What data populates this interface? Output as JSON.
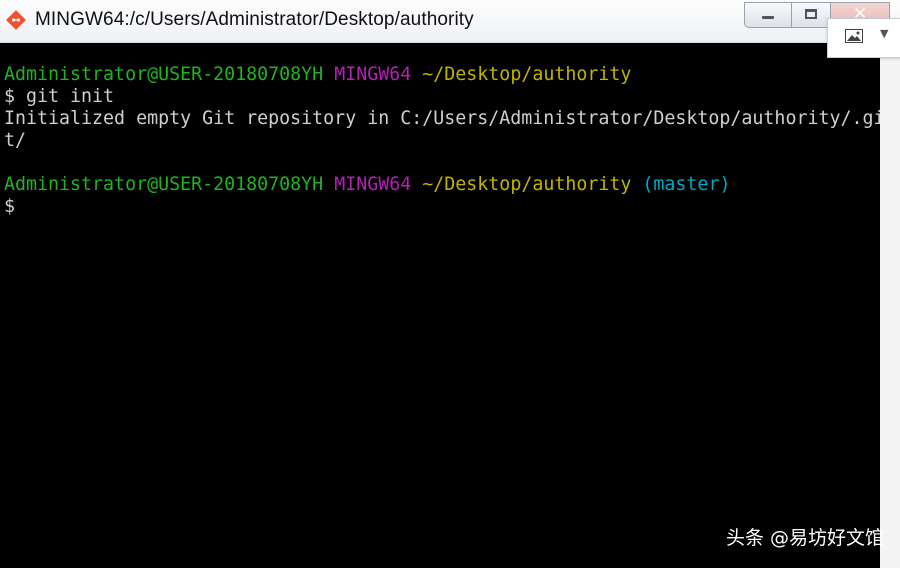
{
  "window": {
    "title": "MINGW64:/c/Users/Administrator/Desktop/authority"
  },
  "terminal": {
    "prompt1": {
      "user": "Administrator@USER-20180708YH",
      "system": "MINGW64",
      "path": "~/Desktop/authority"
    },
    "command1": "$ git init",
    "output1_line1": "Initialized empty Git repository in C:/Users/Administrator/Desktop/authority/.gi",
    "output1_line2": "t/",
    "prompt2": {
      "user": "Administrator@USER-20180708YH",
      "system": "MINGW64",
      "path": "~/Desktop/authority",
      "branch": "(master)"
    },
    "cursor_prompt": "$"
  },
  "watermark": {
    "text": "头条 @易坊好文馆"
  },
  "colors": {
    "terminal_bg": "#000000",
    "user": "#1fb41f",
    "system": "#b320b3",
    "path": "#c1b300",
    "branch": "#00a8c6",
    "text": "#cfcfcf"
  },
  "icons": {
    "app": "git-bash-icon",
    "popup": "image-icon"
  }
}
